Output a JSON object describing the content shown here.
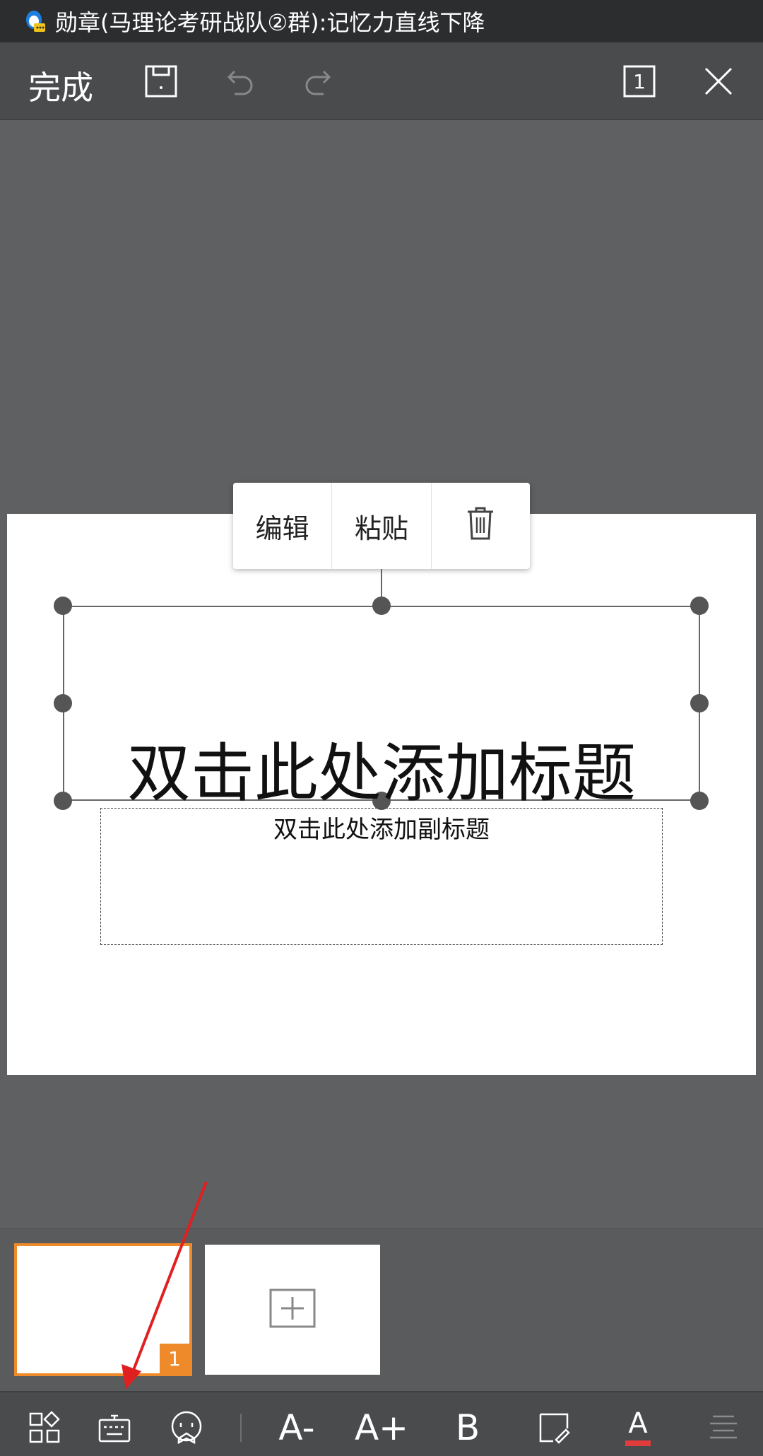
{
  "status_bar": {
    "notification_text": "勋章(马理论考研战队②群):记忆力直线下降",
    "notification_icon": "qq-icon"
  },
  "toolbar": {
    "done_label": "完成",
    "icons": [
      "save-icon",
      "undo-icon",
      "redo-icon",
      "slide-count-icon",
      "close-icon"
    ],
    "slide_count": "1"
  },
  "context_menu": {
    "edit_label": "编辑",
    "paste_label": "粘贴",
    "delete_icon": "trash-icon"
  },
  "slide": {
    "title_placeholder": "双击此处添加标题",
    "subtitle_placeholder": "双击此处添加副标题"
  },
  "thumbnails": {
    "active_slide_number": "1",
    "add_slide_icon": "plus-box-icon"
  },
  "bottom_toolbar": {
    "icons": [
      "layout-icon",
      "keyboard-icon",
      "emoji-icon",
      "font-decrease-icon",
      "font-increase-icon",
      "bold-icon",
      "highlighter-icon",
      "font-color-icon",
      "align-icon"
    ],
    "font_decrease_glyph": "A-",
    "font_increase_glyph": "A+",
    "bold_glyph": "B",
    "font_color_glyph": "A"
  },
  "colors": {
    "accent": "#ef8a2a",
    "font_color_indicator": "#e03c3c",
    "annotation_arrow": "#e02020"
  }
}
